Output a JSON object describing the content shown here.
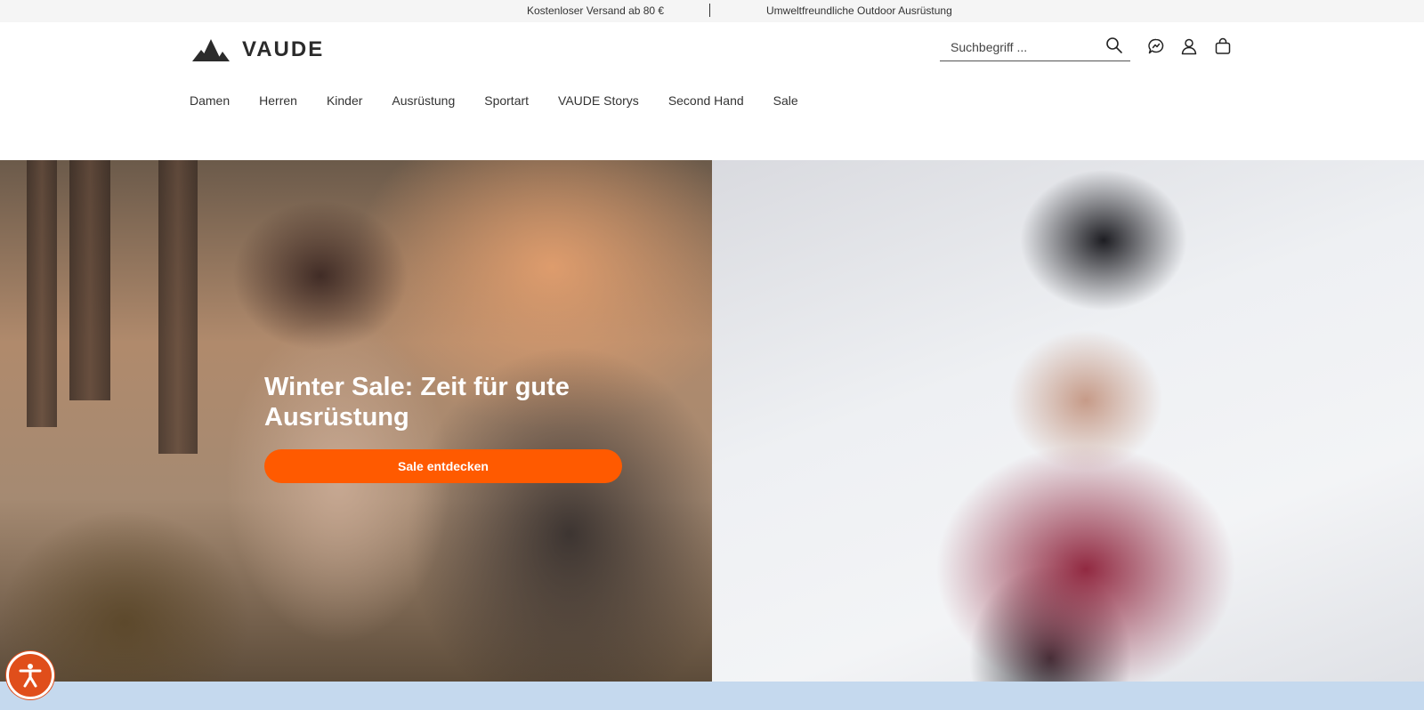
{
  "topbar": {
    "message_1": "Kostenloser Versand ab 80 €",
    "message_2": "Umweltfreundliche Outdoor Ausrüstung"
  },
  "header": {
    "logo_text": "VAUDE",
    "search": {
      "placeholder": "Suchbegriff ..."
    },
    "icons": [
      "search-icon",
      "chat-icon",
      "account-icon",
      "cart-icon"
    ]
  },
  "nav": {
    "items": [
      {
        "label": "Damen"
      },
      {
        "label": "Herren"
      },
      {
        "label": "Kinder"
      },
      {
        "label": "Ausrüstung"
      },
      {
        "label": "Sportart"
      },
      {
        "label": "VAUDE Storys"
      },
      {
        "label": "Second Hand"
      },
      {
        "label": "Sale"
      }
    ]
  },
  "hero": {
    "title": "Winter Sale: Zeit für gute Ausrüstung",
    "cta_label": "Sale entdecken"
  },
  "colors": {
    "accent": "#ff5a00",
    "accessibility_button": "#e04e1b",
    "topbar_bg": "#f5f5f5",
    "bottom_band": "#c5d9ee"
  },
  "accessibility": {
    "icon": "accessibility-icon"
  }
}
